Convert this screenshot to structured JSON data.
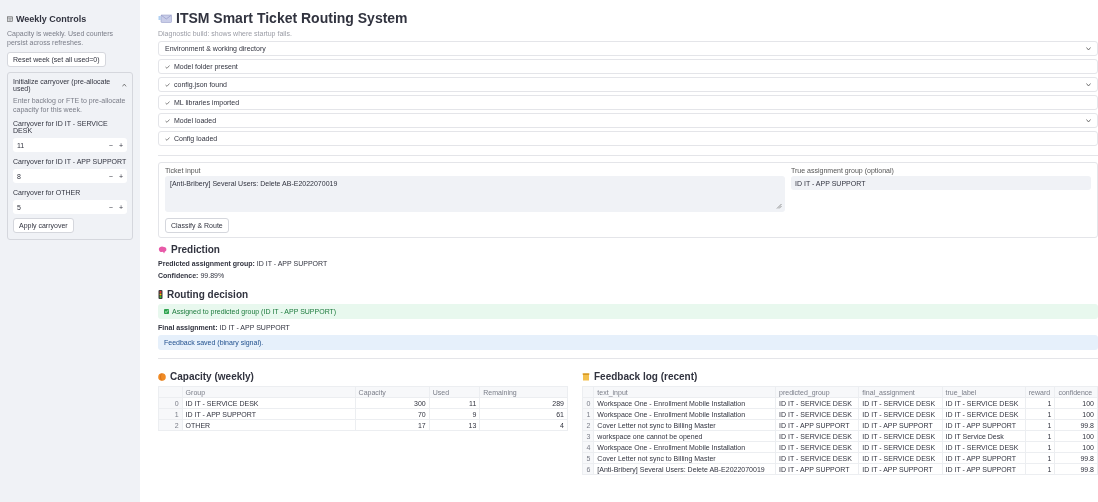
{
  "sidebar": {
    "title": "Weekly Controls",
    "caption": "Capacity is weekly. Used counters persist across refreshes.",
    "reset_button": "Reset week (set all used=0)",
    "expander": {
      "label": "Initialize carryover (pre-allocate used)",
      "expanded": true,
      "caption": "Enter backlog or FTE to pre-allocate capacity for this week.",
      "inputs": [
        {
          "label": "Carryover for ID IT - SERVICE DESK",
          "value": "11"
        },
        {
          "label": "Carryover for ID IT - APP SUPPORT",
          "value": "8"
        },
        {
          "label": "Carryover for OTHER",
          "value": "5"
        }
      ],
      "stepper": [
        "−",
        "+"
      ],
      "button": "Apply carryover"
    }
  },
  "title": "ITSM Smart Ticket Routing System",
  "subtitle": "Diagnostic build: shows where startup fails.",
  "diagnostics": [
    {
      "label": "Environment & working directory",
      "checked": false,
      "chevron": true
    },
    {
      "label": "Model folder present",
      "checked": true,
      "chevron": false
    },
    {
      "label": "config.json found",
      "checked": true,
      "chevron": true
    },
    {
      "label": "ML libraries imported",
      "checked": true,
      "chevron": false
    },
    {
      "label": "Model loaded",
      "checked": true,
      "chevron": true
    },
    {
      "label": "Config loaded",
      "checked": true,
      "chevron": false
    }
  ],
  "form": {
    "ticket_label": "Ticket input",
    "ticket_value": "[Anti-Bribery] Several Users: Delete AB-E2022070019",
    "group_label": "True assignment group (optional)",
    "group_value": "ID IT - APP SUPPORT",
    "button": "Classify & Route"
  },
  "prediction": {
    "heading": "Prediction",
    "lines": [
      "**Predicted assignment group:** ID IT - APP SUPPORT",
      "**Confidence:** 99.89%"
    ]
  },
  "routing": {
    "heading": "Routing decision",
    "success": "Assigned to predicted group (ID IT - APP SUPPORT)",
    "final": "**Final assignment:** ID IT - APP SUPPORT",
    "info": "Feedback saved (binary signal)."
  },
  "capacity": {
    "heading": "Capacity (weekly)",
    "columns": [
      "Group",
      "Capacity",
      "Used",
      "Remaining"
    ],
    "rows": [
      {
        "index": "0",
        "cells": [
          "ID IT - SERVICE DESK",
          "300",
          "11",
          "289"
        ]
      },
      {
        "index": "1",
        "cells": [
          "ID IT - APP SUPPORT",
          "70",
          "9",
          "61"
        ]
      },
      {
        "index": "2",
        "cells": [
          "OTHER",
          "17",
          "13",
          "4"
        ]
      }
    ]
  },
  "feedback": {
    "heading": "Feedback log (recent)",
    "columns": [
      "text_input",
      "predicted_group",
      "final_assignment",
      "true_label",
      "reward",
      "confidence"
    ],
    "rows": [
      {
        "index": "0",
        "cells": [
          "Workspace One - Enrollment Mobile Installation",
          "ID IT - SERVICE DESK",
          "ID IT - SERVICE DESK",
          "ID IT - SERVICE DESK",
          "1",
          "100"
        ]
      },
      {
        "index": "1",
        "cells": [
          "Workspace One - Enrollment Mobile Installation",
          "ID IT - SERVICE DESK",
          "ID IT - SERVICE DESK",
          "ID IT - SERVICE DESK",
          "1",
          "100"
        ]
      },
      {
        "index": "2",
        "cells": [
          "Cover Letter not sync to Billing Master",
          "ID IT - APP SUPPORT",
          "ID IT - APP SUPPORT",
          "ID IT - APP SUPPORT",
          "1",
          "99.8"
        ]
      },
      {
        "index": "3",
        "cells": [
          "workspace one cannot be opened",
          "ID IT - SERVICE DESK",
          "ID IT - SERVICE DESK",
          "ID IT Service Desk",
          "1",
          "100"
        ]
      },
      {
        "index": "4",
        "cells": [
          "Workspace One - Enrollment Mobile Installation",
          "ID IT - SERVICE DESK",
          "ID IT - SERVICE DESK",
          "ID IT - SERVICE DESK",
          "1",
          "100"
        ]
      },
      {
        "index": "5",
        "cells": [
          "Cover Letter not sync to Billing Master",
          "ID IT - SERVICE DESK",
          "ID IT - SERVICE DESK",
          "ID IT - APP SUPPORT",
          "1",
          "99.8"
        ]
      },
      {
        "index": "6",
        "cells": [
          "[Anti-Bribery] Several Users: Delete AB-E2022070019",
          "ID IT - APP SUPPORT",
          "ID IT - APP SUPPORT",
          "ID IT - APP SUPPORT",
          "1",
          "99.8"
        ]
      }
    ]
  }
}
